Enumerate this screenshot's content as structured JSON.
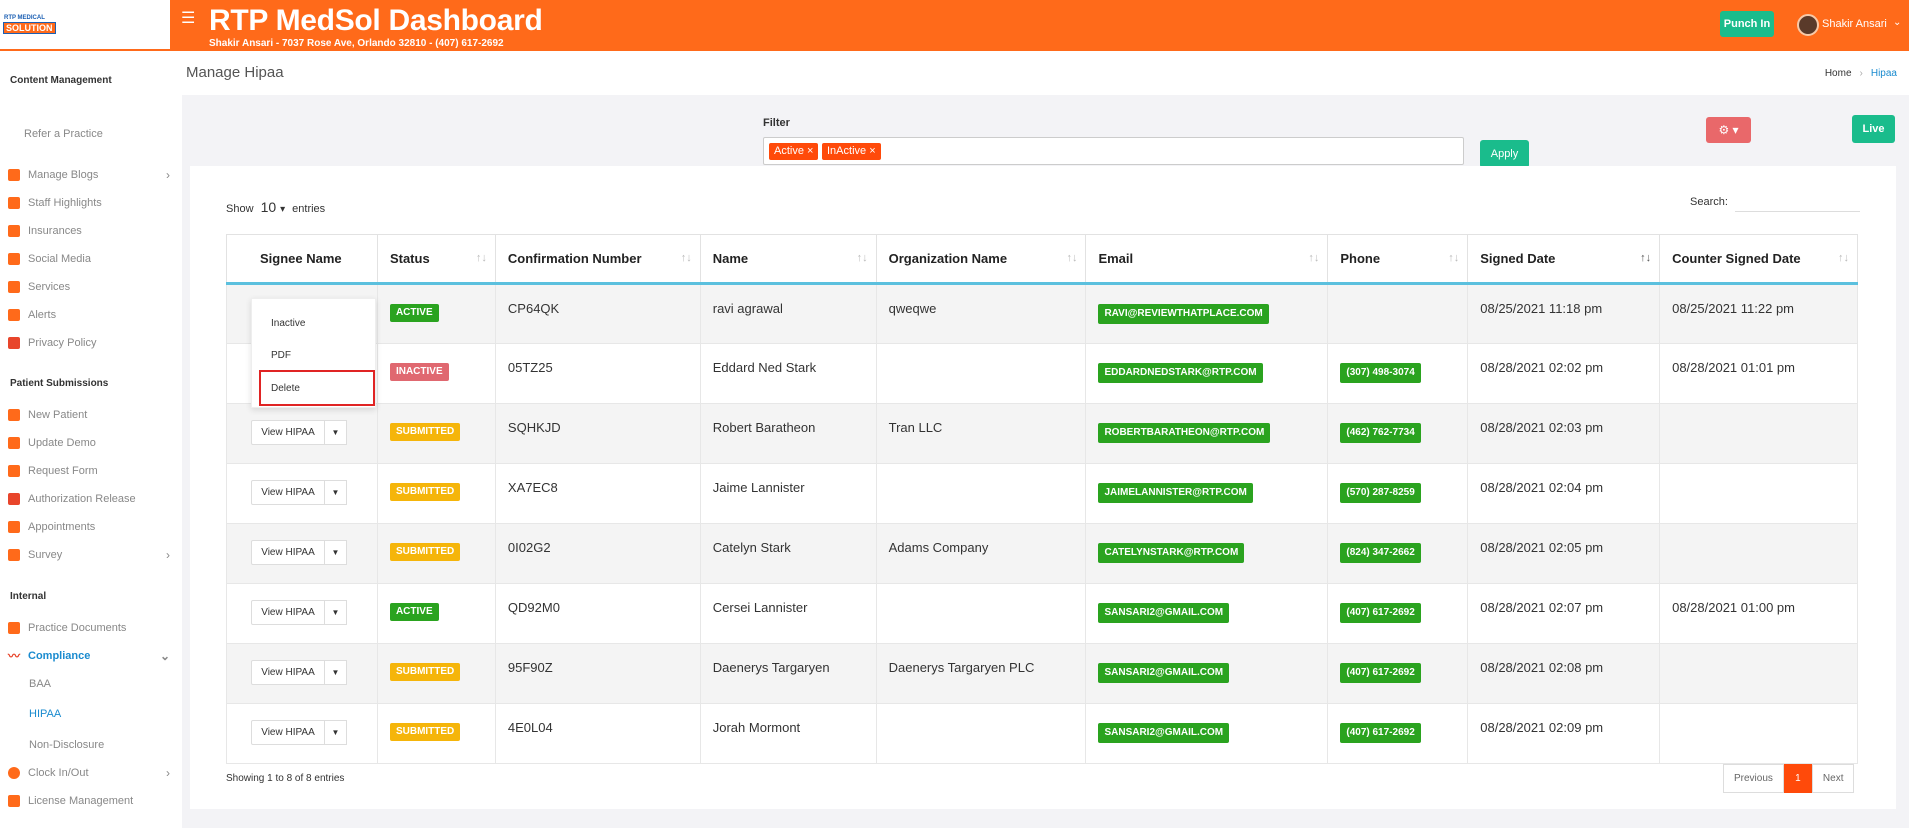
{
  "brand": {
    "logo_top": "RTP MEDICAL",
    "logo_bottom": "SOLUTION",
    "title": "RTP MedSol Dashboard",
    "subtitle": "Shakir Ansari - 7037 Rose Ave, Orlando 32810 - (407) 617-2692",
    "color": "#ff6a1a"
  },
  "header": {
    "punch_label": "Punch In",
    "user_name": "Shakir Ansari"
  },
  "sidebar": {
    "section_content": "Content Management",
    "refer": "Refer a Practice",
    "content_items": [
      "Manage Blogs",
      "Staff Highlights",
      "Insurances",
      "Social Media",
      "Services",
      "Alerts",
      "Privacy Policy"
    ],
    "section_patient": "Patient Submissions",
    "patient_items": [
      "New Patient",
      "Update Demo",
      "Request Form",
      "Authorization Release",
      "Appointments",
      "Survey"
    ],
    "section_internal": "Internal",
    "internal_items": [
      "Practice Documents",
      "Compliance"
    ],
    "compliance_sub": [
      "BAA",
      "HIPAA",
      "Non-Disclosure"
    ],
    "bottom_items": [
      "Clock In/Out",
      "License Management"
    ]
  },
  "page": {
    "title": "Manage Hipaa",
    "breadcrumb_home": "Home",
    "breadcrumb_current": "Hipaa"
  },
  "filter": {
    "label": "Filter",
    "tags": [
      "Active",
      "InActive"
    ],
    "apply_label": "Apply",
    "live_label": "Live"
  },
  "table_controls": {
    "show_label": "Show",
    "length": "10",
    "entries_label": "entries",
    "search_label": "Search:"
  },
  "table": {
    "columns": [
      "Signee Name",
      "Status",
      "Confirmation Number",
      "Name",
      "Organization Name",
      "Email",
      "Phone",
      "Signed Date",
      "Counter Signed Date"
    ],
    "action_label": "View HIPAA",
    "rows": [
      {
        "status": "ACTIVE",
        "conf": "CP64QK",
        "name": "ravi agrawal",
        "org": "qweqwe",
        "email": "RAVI@REVIEWTHATPLACE.COM",
        "phone": "",
        "signed": "08/25/2021 11:18 pm",
        "counter": "08/25/2021 11:22 pm"
      },
      {
        "status": "INACTIVE",
        "conf": "05TZ25",
        "name": "Eddard Ned Stark",
        "org": "",
        "email": "EDDARDNEDSTARK@RTP.COM",
        "phone": "(307) 498-3074",
        "signed": "08/28/2021 02:02 pm",
        "counter": "08/28/2021 01:01 pm"
      },
      {
        "status": "SUBMITTED",
        "conf": "SQHKJD",
        "name": "Robert Baratheon",
        "org": "Tran LLC",
        "email": "ROBERTBARATHEON@RTP.COM",
        "phone": "(462) 762-7734",
        "signed": "08/28/2021 02:03 pm",
        "counter": ""
      },
      {
        "status": "SUBMITTED",
        "conf": "XA7EC8",
        "name": "Jaime Lannister",
        "org": "",
        "email": "JAIMELANNISTER@RTP.COM",
        "phone": "(570) 287-8259",
        "signed": "08/28/2021 02:04 pm",
        "counter": ""
      },
      {
        "status": "SUBMITTED",
        "conf": "0I02G2",
        "name": "Catelyn Stark",
        "org": "Adams Company",
        "email": "CATELYNSTARK@RTP.COM",
        "phone": "(824) 347-2662",
        "signed": "08/28/2021 02:05 pm",
        "counter": ""
      },
      {
        "status": "ACTIVE",
        "conf": "QD92M0",
        "name": "Cersei Lannister",
        "org": "",
        "email": "SANSARI2@GMAIL.COM",
        "phone": "(407) 617-2692",
        "signed": "08/28/2021 02:07 pm",
        "counter": "08/28/2021 01:00 pm"
      },
      {
        "status": "SUBMITTED",
        "conf": "95F90Z",
        "name": "Daenerys Targaryen",
        "org": "Daenerys Targaryen PLC",
        "email": "SANSARI2@GMAIL.COM",
        "phone": "(407) 617-2692",
        "signed": "08/28/2021 02:08 pm",
        "counter": ""
      },
      {
        "status": "SUBMITTED",
        "conf": "4E0L04",
        "name": "Jorah Mormont",
        "org": "",
        "email": "SANSARI2@GMAIL.COM",
        "phone": "(407) 617-2692",
        "signed": "08/28/2021 02:09 pm",
        "counter": ""
      }
    ]
  },
  "dropdown_menu": [
    "Inactive",
    "PDF",
    "Delete"
  ],
  "footer": {
    "info": "Showing 1 to 8 of 8 entries",
    "prev": "Previous",
    "page": "1",
    "next": "Next"
  }
}
